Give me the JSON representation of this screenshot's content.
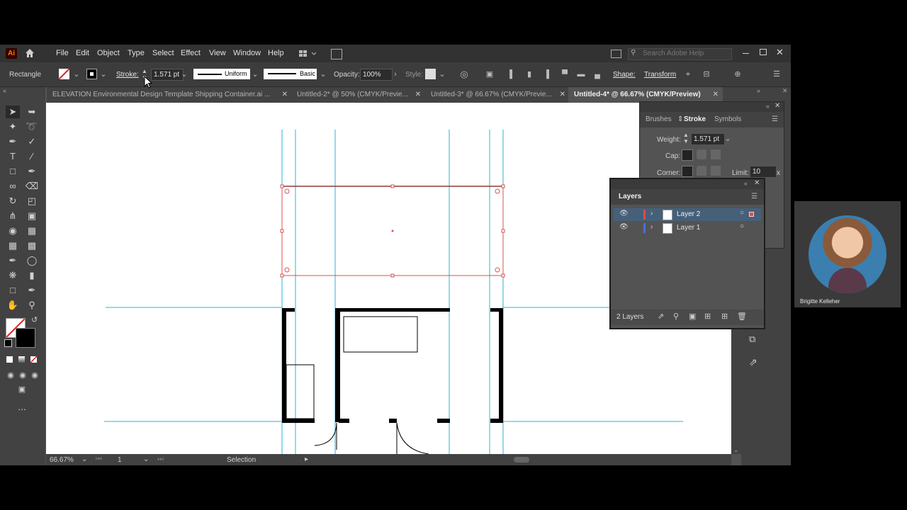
{
  "menu": {
    "logo": "Ai",
    "items": [
      "File",
      "Edit",
      "Object",
      "Type",
      "Select",
      "Effect",
      "View",
      "Window",
      "Help"
    ],
    "search_placeholder": "Search Adobe Help"
  },
  "control": {
    "tool_name": "Rectangle",
    "stroke_label": "Stroke:",
    "stroke_weight": "1.571 pt",
    "profile": "Uniform",
    "brush": "Basic",
    "opacity_label": "Opacity:",
    "opacity": "100%",
    "style_label": "Style:",
    "shape_label": "Shape:",
    "transform_label": "Transform"
  },
  "tabs": [
    {
      "label": "ELEVATION Environmental Design Template Shipping Container.ai ...",
      "active": false
    },
    {
      "label": "Untitled-2* @ 50% (CMYK/Previe...",
      "active": false
    },
    {
      "label": "Untitled-3* @ 66.67% (CMYK/Previe...",
      "active": false
    },
    {
      "label": "Untitled-4* @ 66.67% (CMYK/Preview)",
      "active": true
    }
  ],
  "stroke_panel": {
    "tabs": [
      "Brushes",
      "Stroke",
      "Symbols"
    ],
    "weight_label": "Weight:",
    "weight": "1.571 pt",
    "cap_label": "Cap:",
    "corner_label": "Corner:",
    "limit_label": "Limit:",
    "limit": "10",
    "limit_unit": "x"
  },
  "layers_panel": {
    "title": "Layers",
    "layers": [
      {
        "name": "Layer 2",
        "color": "#4a90e2",
        "selected": true
      },
      {
        "name": "Layer 1",
        "color": "#d9534f",
        "selected": false
      }
    ],
    "count": "2 Layers"
  },
  "status": {
    "zoom": "66.67%",
    "artboard": "1",
    "mode": "Selection"
  },
  "webcam": {
    "name": "Brigitte Kelleher"
  },
  "colors": {
    "guide": "#2bb3d6",
    "selection": "#d9534f",
    "accent_active_layer": "#46607a"
  }
}
